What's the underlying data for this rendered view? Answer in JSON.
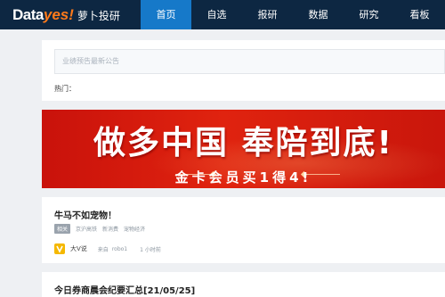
{
  "logo": {
    "part1": "Data",
    "part2": "yes!",
    "cn": "萝卜投研"
  },
  "nav": {
    "items": [
      {
        "label": "首页",
        "active": true
      },
      {
        "label": "自选",
        "active": false
      },
      {
        "label": "报研",
        "active": false
      },
      {
        "label": "数据",
        "active": false
      },
      {
        "label": "研究",
        "active": false
      },
      {
        "label": "看板",
        "active": false
      }
    ]
  },
  "search": {
    "placeholder": "业绩预告最新公告",
    "hot_label": "热门："
  },
  "banner": {
    "title": "做多中国  奉陪到底!",
    "subtitle": "金卡会员买1得4!"
  },
  "feed": [
    {
      "title": "牛马不如宠物！",
      "badge": "相关",
      "tags": [
        "京沪高铁",
        "新消费",
        "宠物经济"
      ],
      "author": "大V说",
      "from_label": "来自",
      "source": "robo1",
      "time": "1 小时前"
    },
    {
      "title": "今日券商晨会纪要汇总[21/05/25]"
    }
  ],
  "colors": {
    "nav_bg": "#0d2742",
    "nav_active": "#1679c9",
    "banner_red": "#d41a0c",
    "logo_orange": "#ff7a1a"
  }
}
